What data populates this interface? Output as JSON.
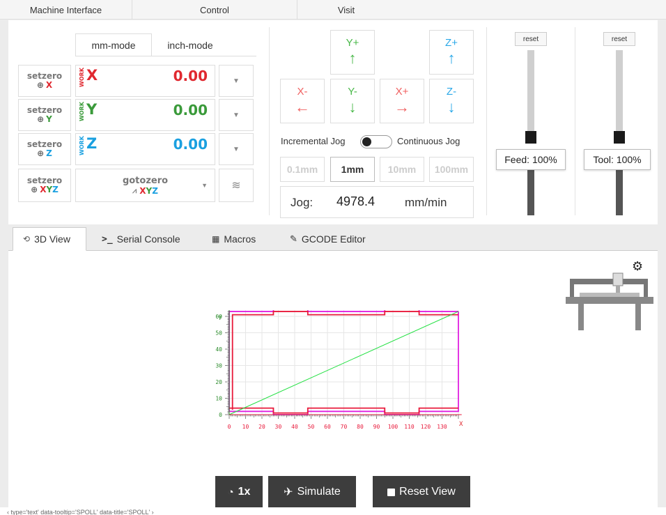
{
  "topnav": {
    "tabs": [
      "Machine Interface",
      "Control",
      "Visit"
    ]
  },
  "dro": {
    "modes": [
      "mm-mode",
      "inch-mode"
    ],
    "work_label": "WORK",
    "setzero_label": "setzero",
    "axes": [
      {
        "axis": "X",
        "value": "0.00",
        "color": "#e0282f"
      },
      {
        "axis": "Y",
        "value": "0.00",
        "color": "#3a9a3a"
      },
      {
        "axis": "Z",
        "value": "0.00",
        "color": "#1aa0e0"
      }
    ],
    "setzero_xyz_label": "XYZ",
    "gotozero_label": "gotozero",
    "gotozero_xyz": "XYZ"
  },
  "jog": {
    "buttons": {
      "yplus": "Y+",
      "zplus": "Z+",
      "xminus": "X-",
      "yminus": "Y-",
      "xplus": "X+",
      "zminus": "Z-"
    },
    "incremental_label": "Incremental Jog",
    "continuous_label": "Continuous Jog",
    "steps": [
      "0.1mm",
      "1mm",
      "10mm",
      "100mm"
    ],
    "active_step": "1mm",
    "rate_label": "Jog:",
    "rate_value": "4978.4",
    "rate_unit": "mm/min"
  },
  "overrides": {
    "reset_label": "reset",
    "feed_label": "Feed: 100%",
    "tool_label": "Tool: 100%",
    "feed_level": 1.0,
    "tool_level": 1.0
  },
  "view_tabs": [
    "3D View",
    "Serial Console",
    "Macros",
    "GCODE Editor"
  ],
  "viewer": {
    "y_axis_label": "Y",
    "x_axis_label": "X",
    "y_ticks": [
      "60",
      "50",
      "40",
      "30",
      "20",
      "10",
      "0"
    ],
    "x_ticks": [
      "0",
      "10",
      "20",
      "30",
      "40",
      "50",
      "60",
      "70",
      "80",
      "90",
      "100",
      "110",
      "120",
      "130"
    ],
    "speed_label": "1x",
    "simulate_label": "Simulate",
    "reset_view_label": "Reset View"
  },
  "colors": {
    "accent_green": "#3a9a3a",
    "accent_red": "#e0282f",
    "accent_blue": "#1aa0e0",
    "arrow_red": "#f06060",
    "arrow_green": "#48b848",
    "arrow_blue": "#29a8e8",
    "toolpath_red": "#e8193a",
    "toolpath_magenta": "#e020e0",
    "toolpath_green": "#20e040"
  },
  "footer_text": "‹ type='text' data-tooltip='SPOLL' data-title='SPOLL' ›"
}
